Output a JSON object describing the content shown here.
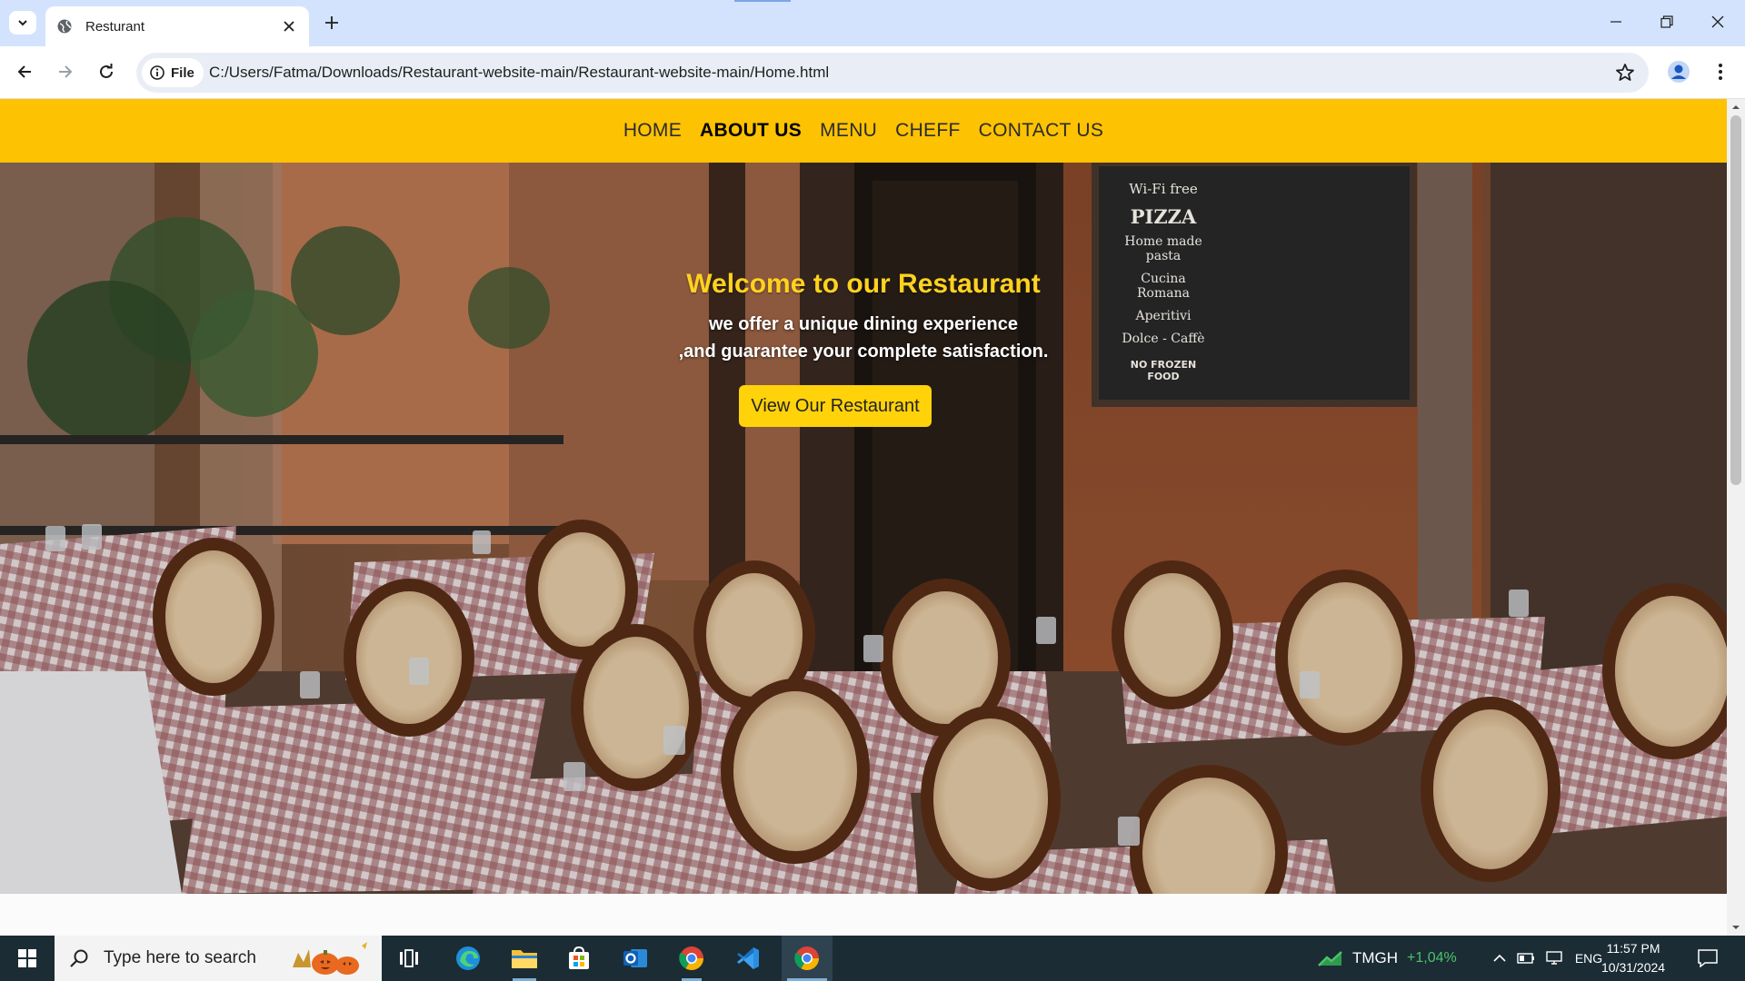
{
  "browser": {
    "tab_title": "Resturant",
    "site_chip": "File",
    "url": "C:/Users/Fatma/Downloads/Restaurant-website-main/Restaurant-website-main/Home.html"
  },
  "nav": {
    "items": [
      "HOME",
      "ABOUT US",
      "MENU",
      "CHEFF",
      "CONTACT US"
    ],
    "active": "ABOUT US"
  },
  "hero": {
    "title": "Welcome to our Restaurant",
    "line1": "we offer a unique dining experience",
    "line2": ",and guarantee your complete satisfaction.",
    "button": "View Our Restaurant",
    "chalkboard": [
      "Wi-Fi free",
      "PIZZA",
      "Home made pasta",
      "Cucina Romana",
      "Aperitivi",
      "Dolce - Caffè",
      "NO FROZEN FOOD"
    ]
  },
  "taskbar": {
    "search_placeholder": "Type here to search",
    "stock_ticker": "TMGH",
    "stock_change": "+1,04%",
    "language": "ENG",
    "time": "11:57 PM",
    "date": "10/31/2024"
  },
  "colors": {
    "nav_bg": "#fdc202",
    "hero_title": "#ffd21f",
    "button_bg": "#ffd20a",
    "titlebar_bg": "#d3e3fd",
    "taskbar_bg": "#1b2c35",
    "stock_up": "#4cc26a"
  }
}
